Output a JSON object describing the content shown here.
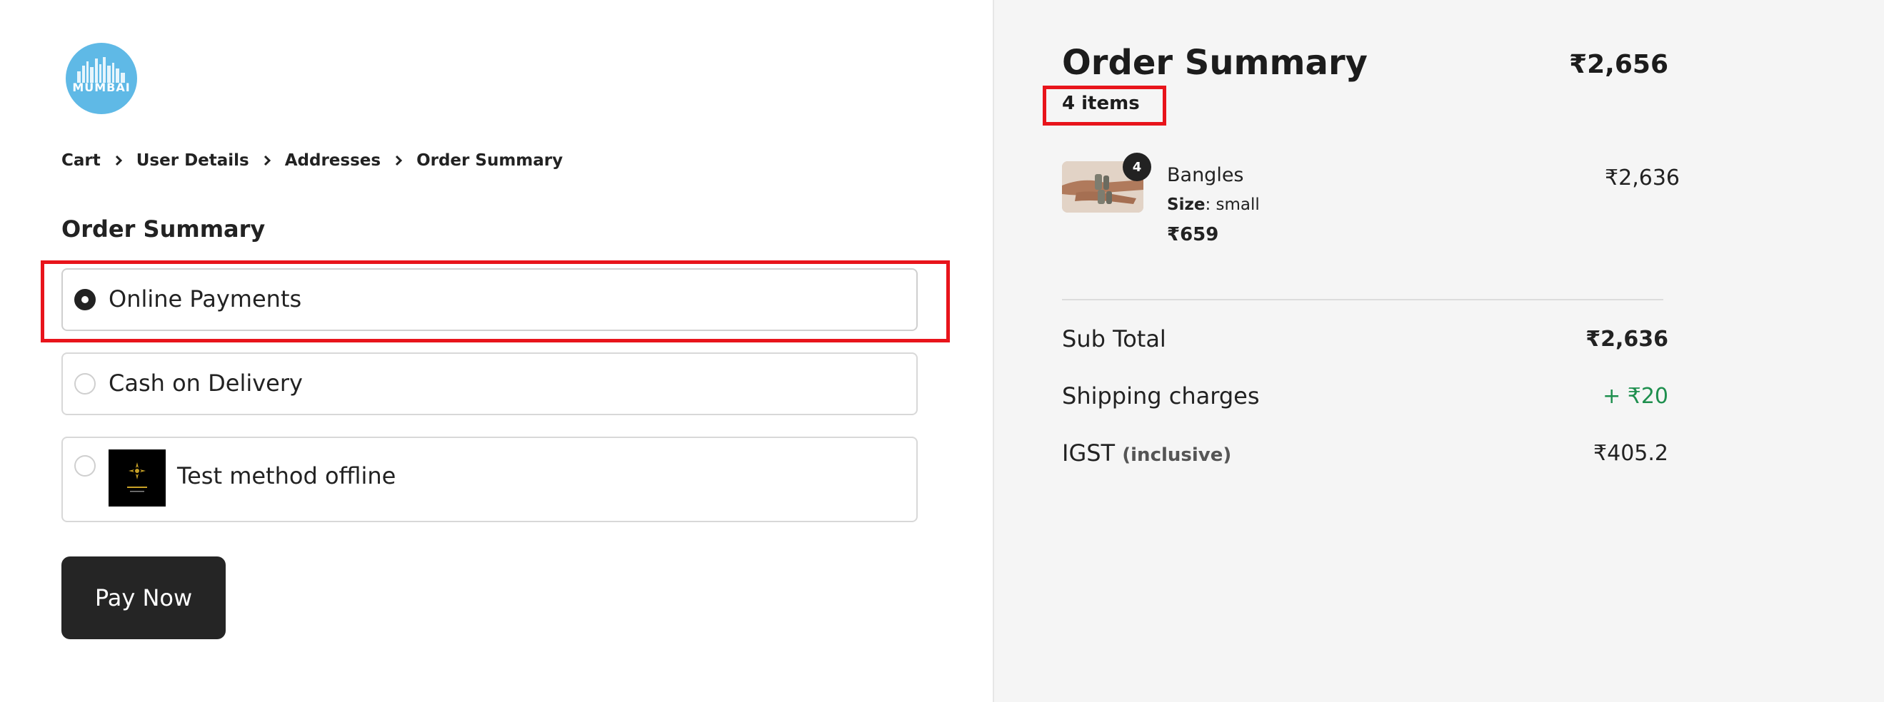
{
  "brand": {
    "logo_text": "MUMBAI",
    "accent": "#5fb9e6"
  },
  "breadcrumb": [
    "Cart",
    "User Details",
    "Addresses",
    "Order Summary"
  ],
  "left": {
    "section_title": "Order Summary",
    "payment_options": [
      {
        "label": "Online Payments",
        "selected": true
      },
      {
        "label": "Cash on Delivery",
        "selected": false
      },
      {
        "label": "Test method offline",
        "selected": false,
        "has_image": true
      }
    ],
    "pay_button": "Pay Now"
  },
  "summary": {
    "title": "Order Summary",
    "total": "₹2,656",
    "items_count": "4 items",
    "items": [
      {
        "name": "Bangles",
        "quantity": "4",
        "size_label": "Size",
        "size_value": ": small",
        "unit_price": "₹659",
        "line_total": "₹2,636"
      }
    ],
    "rows": {
      "subtotal_label": "Sub Total",
      "subtotal_value": "₹2,636",
      "shipping_label": "Shipping charges",
      "shipping_value": "+ ₹20",
      "tax_label": "IGST",
      "tax_note": "(inclusive)",
      "tax_value": "₹405.2"
    }
  },
  "colors": {
    "highlight": "#e8141b",
    "button": "#252525",
    "shipping_green": "#1e8f4e",
    "panel_bg": "#f5f5f5"
  }
}
